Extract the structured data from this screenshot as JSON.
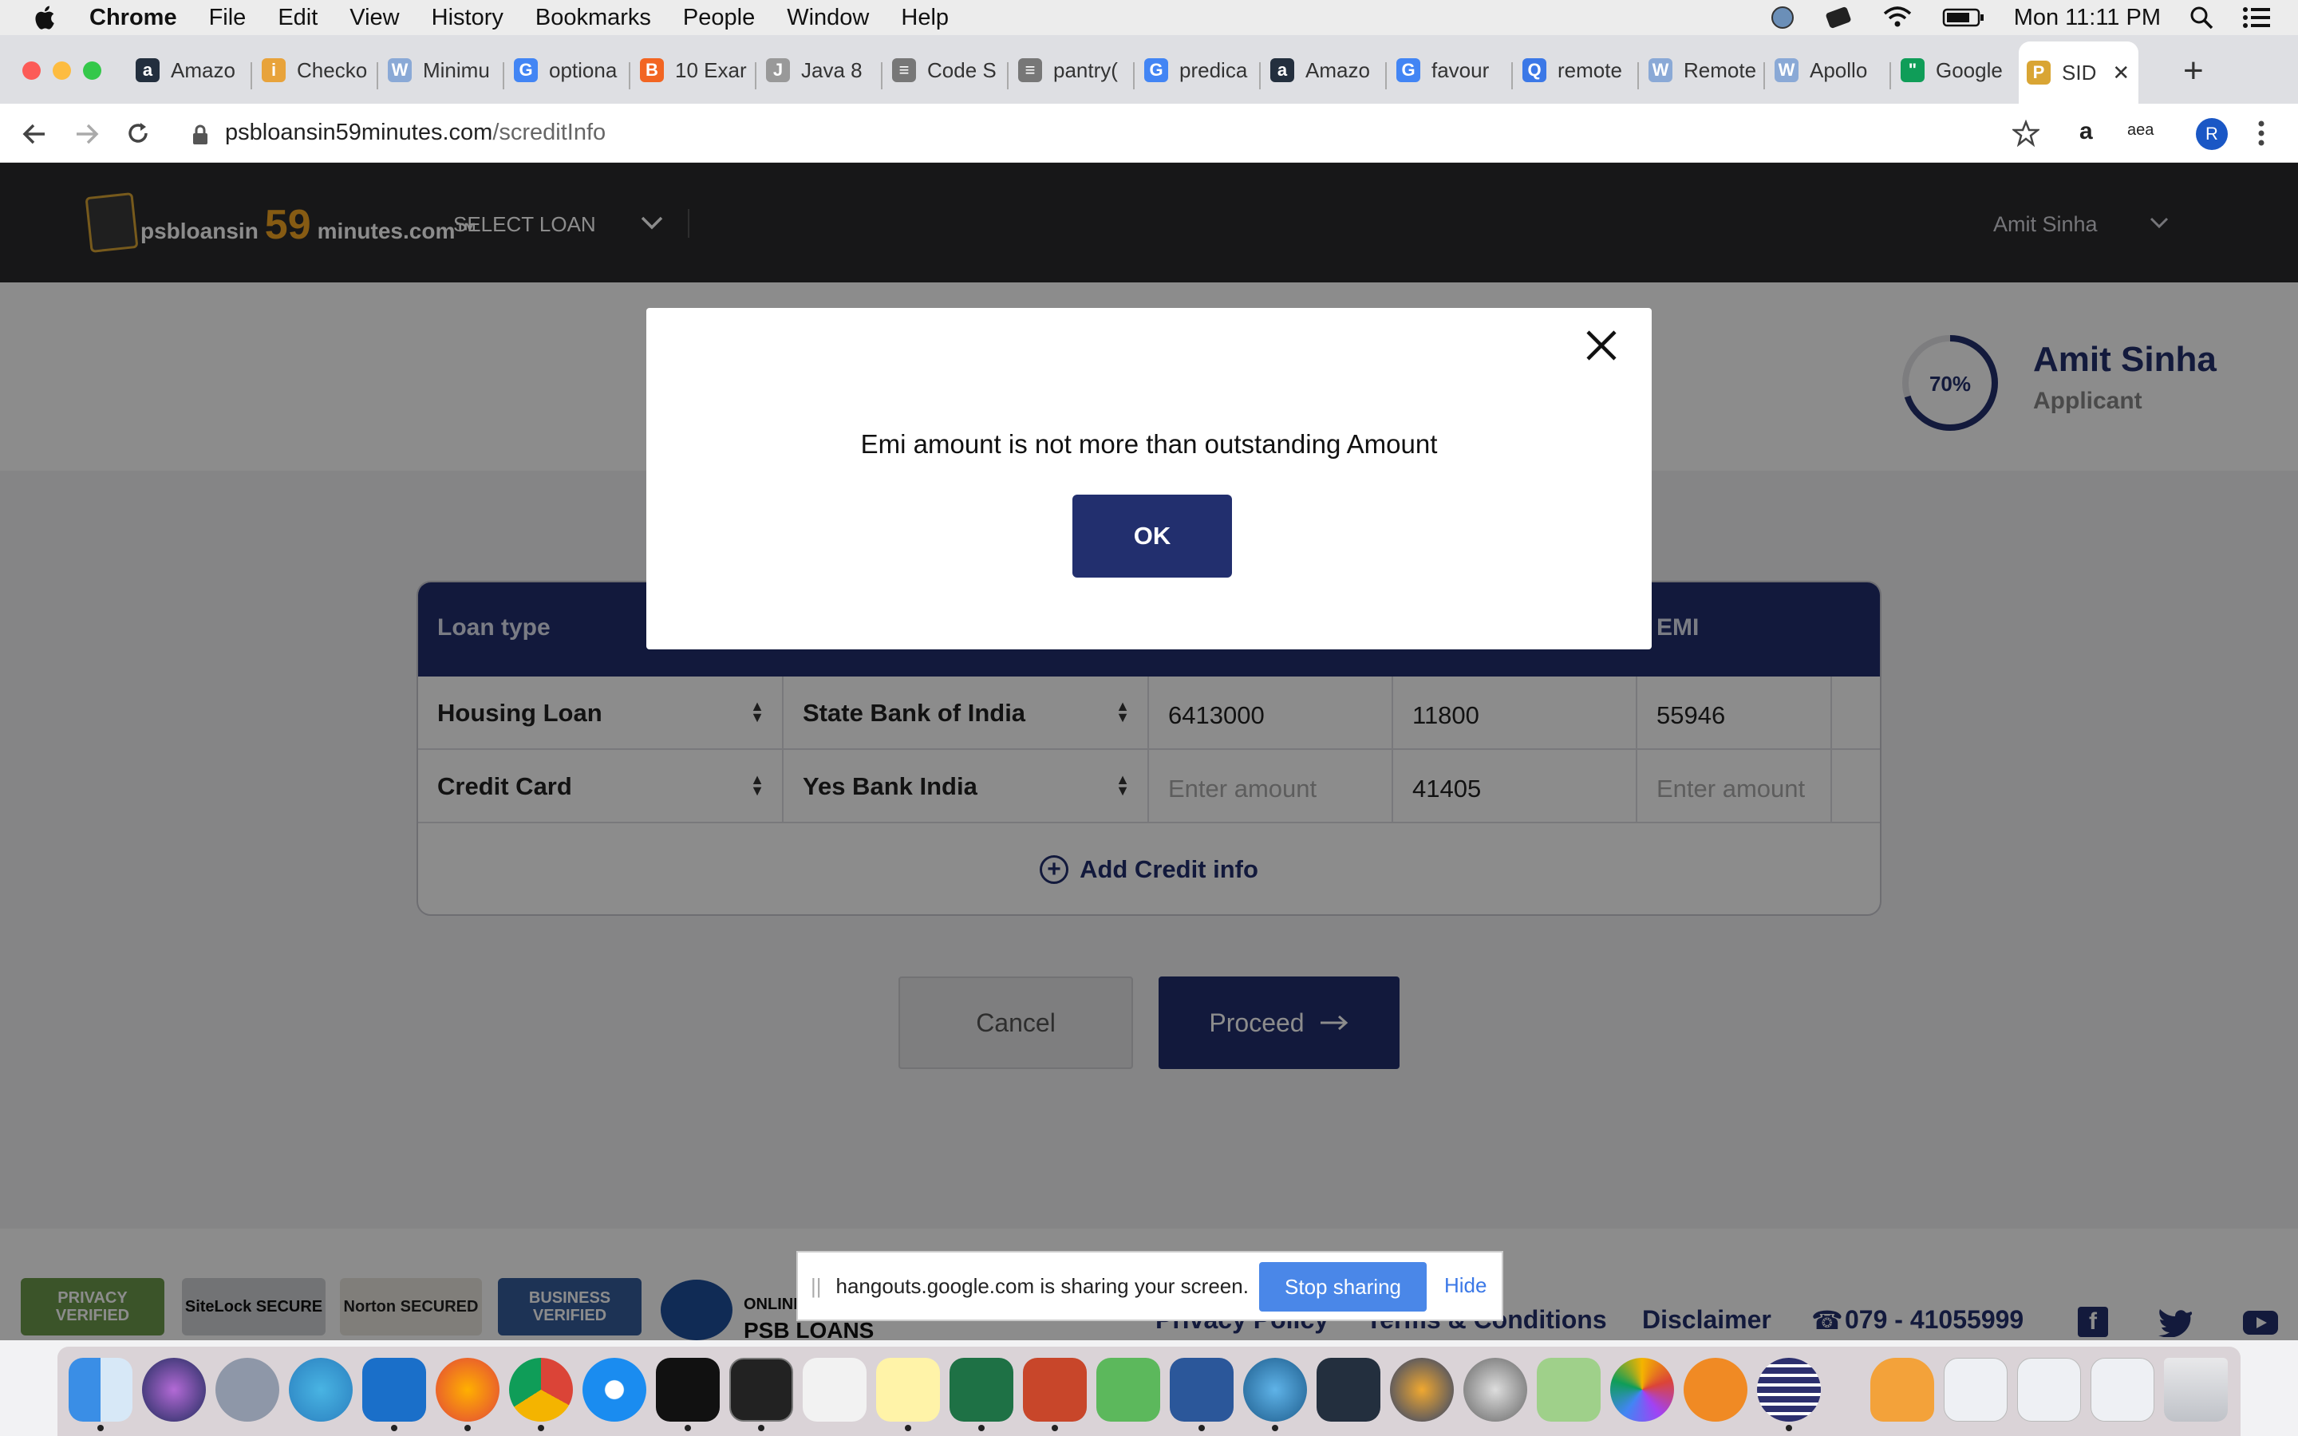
{
  "menubar": {
    "app": "Chrome",
    "items": [
      "File",
      "Edit",
      "View",
      "History",
      "Bookmarks",
      "People",
      "Window",
      "Help"
    ],
    "clock": "Mon 11:11 PM"
  },
  "tabs": [
    {
      "label": "Amazo",
      "fav": "a",
      "color": "#232f3e"
    },
    {
      "label": "Checko",
      "fav": "i",
      "color": "#e8a33b"
    },
    {
      "label": "Minimu",
      "fav": "W",
      "color": "#8aa9d6"
    },
    {
      "label": "optiona",
      "fav": "G",
      "color": "#4285f4"
    },
    {
      "label": "10 Exar",
      "fav": "B",
      "color": "#f26522"
    },
    {
      "label": "Java 8",
      "fav": "J",
      "color": "#999999"
    },
    {
      "label": "Code S",
      "fav": "≡",
      "color": "#777777"
    },
    {
      "label": "pantry(",
      "fav": "≡",
      "color": "#777777"
    },
    {
      "label": "predica",
      "fav": "G",
      "color": "#4285f4"
    },
    {
      "label": "Amazo",
      "fav": "a",
      "color": "#232f3e"
    },
    {
      "label": "favour",
      "fav": "G",
      "color": "#4285f4"
    },
    {
      "label": "remote",
      "fav": "Q",
      "color": "#3b78e7"
    },
    {
      "label": "Remote",
      "fav": "W",
      "color": "#8aa9d6"
    },
    {
      "label": "Apollo",
      "fav": "W",
      "color": "#8aa9d6"
    },
    {
      "label": "Google",
      "fav": "\"",
      "color": "#0f9d58"
    },
    {
      "label": "SID",
      "fav": "P",
      "color": "#d9a534"
    }
  ],
  "address": {
    "host": "psbloansin59minutes.com",
    "path": "/screditInfo"
  },
  "site": {
    "logo_left": "psbloansin",
    "logo_num": "59",
    "logo_right": "minutes.com™",
    "select_loan": "SELECT LOAN",
    "user": "Amit Sinha"
  },
  "profile": {
    "progress": "70%",
    "progress_value": 0.7,
    "name": "Amit Sinha",
    "role": "Applicant"
  },
  "table": {
    "headers": [
      "Loan type",
      "EMI"
    ],
    "rows": [
      {
        "loan_type": "Housing Loan",
        "bank": "State Bank of India",
        "outstanding": "6413000",
        "col4": "11800",
        "emi": "55946",
        "emi_placeholder": false,
        "out_placeholder": false
      },
      {
        "loan_type": "Credit Card",
        "bank": "Yes Bank India",
        "outstanding": "Enter amount",
        "col4": "41405",
        "emi": "Enter amount",
        "emi_placeholder": true,
        "out_placeholder": true
      }
    ],
    "add_label": "Add Credit info"
  },
  "actions": {
    "cancel": "Cancel",
    "proceed": "Proceed"
  },
  "modal": {
    "message": "Emi amount is not more than outstanding Amount",
    "ok": "OK"
  },
  "footer": {
    "badges": [
      "PRIVACY VERIFIED",
      "SiteLock SECURE",
      "Norton SECURED",
      "BUSINESS VERIFIED"
    ],
    "online_label": "ONLINE",
    "psb_label": "PSB LOANS",
    "links": [
      "Privacy Policy",
      "Terms & Conditions",
      "Disclaimer"
    ],
    "phone": "079 - 41055999"
  },
  "sharebar": {
    "message": "hangouts.google.com is sharing your screen.",
    "stop": "Stop sharing",
    "hide": "Hide"
  },
  "colors": {
    "primary": "#222f6e",
    "header": "#2b2b2d",
    "accent": "#f5a623"
  }
}
